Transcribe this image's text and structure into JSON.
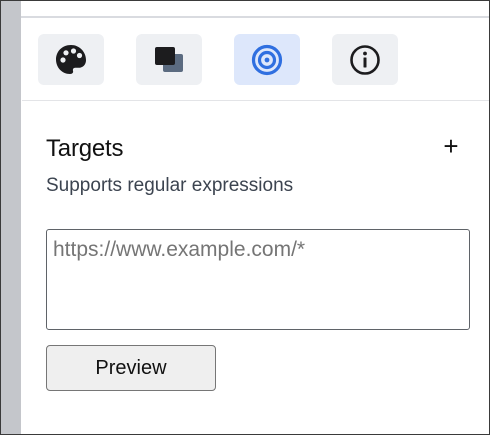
{
  "toolbar": {
    "buttons": [
      {
        "icon": "palette-icon",
        "active": false
      },
      {
        "icon": "layers-icon",
        "active": false
      },
      {
        "icon": "target-icon",
        "active": true
      },
      {
        "icon": "info-icon",
        "active": false
      }
    ],
    "accent_color": "#2f6fe0",
    "active_background": "#dde7fb"
  },
  "targets": {
    "title": "Targets",
    "add_label": "+",
    "subtitle": "Supports regular expressions",
    "input_value": "",
    "input_placeholder": "https://www.example.com/*",
    "preview_label": "Preview"
  }
}
